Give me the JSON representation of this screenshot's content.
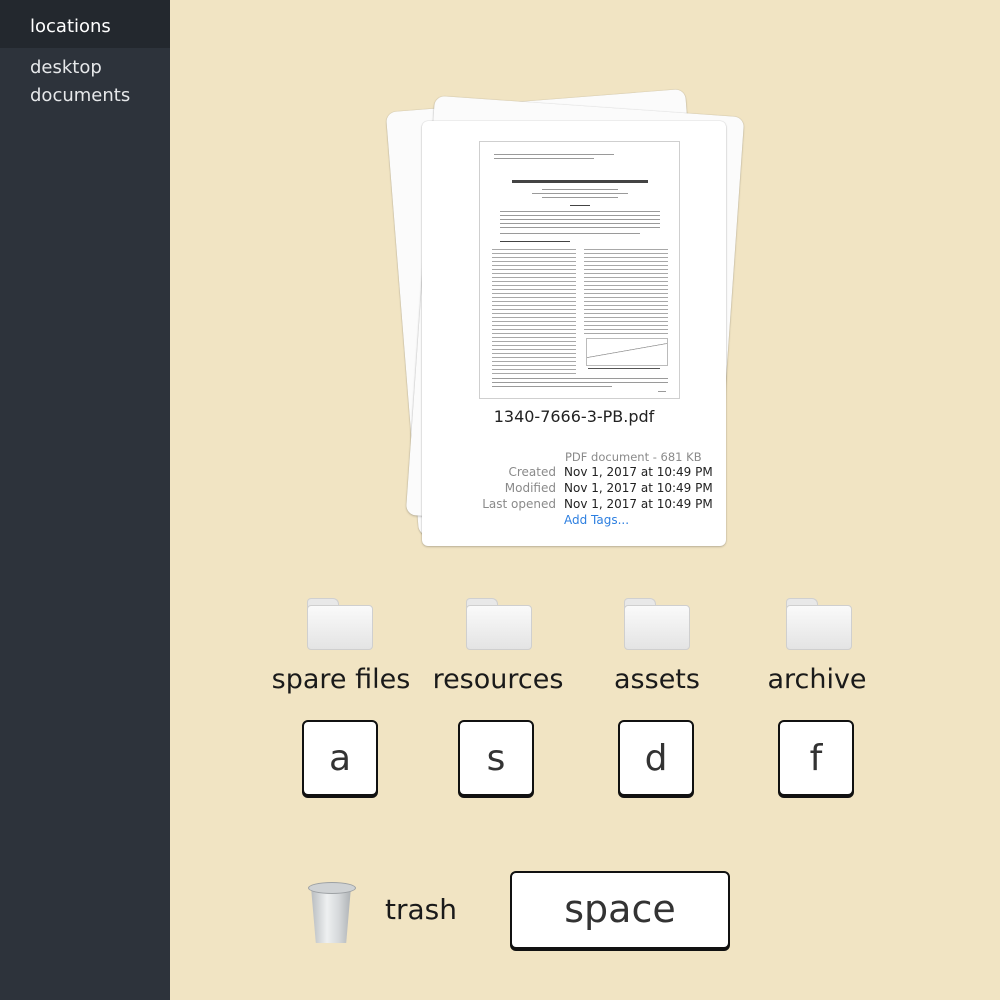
{
  "sidebar": {
    "header": "locations",
    "items": [
      {
        "label": "desktop"
      },
      {
        "label": "documents"
      }
    ]
  },
  "preview": {
    "filename": "1340-7666-3-PB.pdf",
    "kind": "PDF document - 681 KB",
    "created_label": "Created",
    "created_value": "Nov 1, 2017 at 10:49 PM",
    "modified_label": "Modified",
    "modified_value": "Nov 1, 2017 at 10:49 PM",
    "last_opened_label": "Last opened",
    "last_opened_value": "Nov 1, 2017 at 10:49 PM",
    "add_tags": "Add Tags..."
  },
  "folders": [
    {
      "label": "spare  files",
      "key": "a"
    },
    {
      "label": "resources",
      "key": "s"
    },
    {
      "label": "assets",
      "key": "d"
    },
    {
      "label": "archive",
      "key": "f"
    }
  ],
  "trash": {
    "label": "trash",
    "icon": "trash-icon"
  },
  "space_key": {
    "label": "space"
  },
  "colors": {
    "background": "#f1e4c3",
    "sidebar": "#2d333b",
    "sidebar_header": "#23282e",
    "link": "#2d7fe0"
  }
}
